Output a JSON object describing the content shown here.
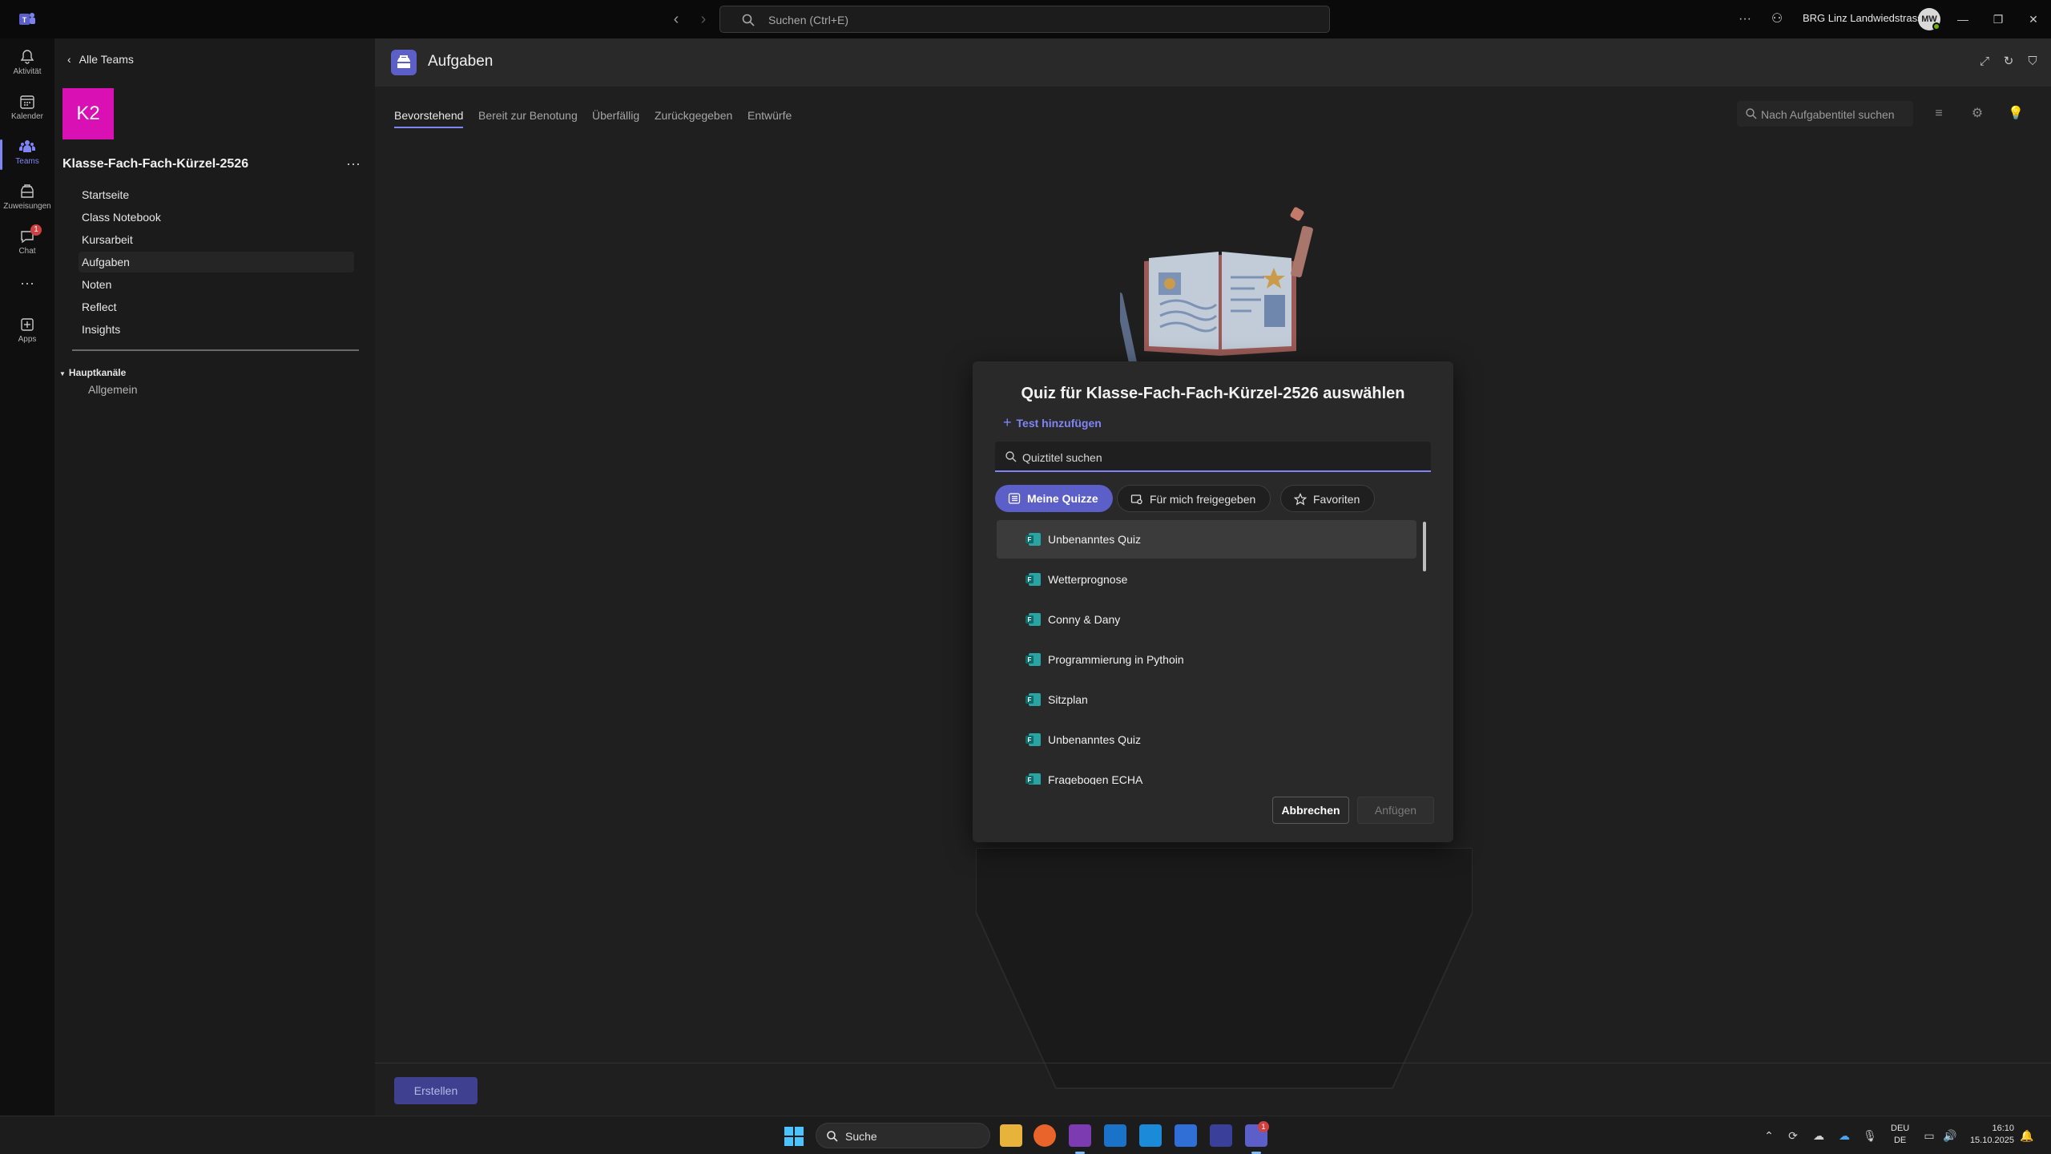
{
  "topbar": {
    "search_placeholder": "Suchen (Ctrl+E)",
    "org_name": "BRG Linz Landwiedstrasse",
    "avatar_initials": "MW"
  },
  "rail": [
    {
      "label": "Aktivität",
      "icon": "bell-icon"
    },
    {
      "label": "Kalender",
      "icon": "calendar-icon"
    },
    {
      "label": "Teams",
      "icon": "teams-icon",
      "active": true
    },
    {
      "label": "Zuweisungen",
      "icon": "assignments-icon"
    },
    {
      "label": "Chat",
      "icon": "chat-icon",
      "badge": "1"
    },
    {
      "label": "Apps",
      "icon": "apps-icon"
    }
  ],
  "team": {
    "back_label": "Alle Teams",
    "avatar_text": "K2",
    "avatar_color": "#d910b4",
    "name": "Klasse-Fach-Fach-Kürzel-2526",
    "nav": [
      "Startseite",
      "Class Notebook",
      "Kursarbeit",
      "Aufgaben",
      "Noten",
      "Reflect",
      "Insights"
    ],
    "active_nav": "Aufgaben",
    "channels_heading": "Hauptkanäle",
    "channels": [
      "Allgemein"
    ]
  },
  "main": {
    "title": "Aufgaben",
    "tabs": [
      "Bevorstehend",
      "Bereit zur Benotung",
      "Überfällig",
      "Zurückgegeben",
      "Entwürfe"
    ],
    "active_tab": "Bevorstehend",
    "search_placeholder": "Nach Aufgabentitel suchen",
    "create_label": "Erstellen"
  },
  "dialog": {
    "title": "Quiz für Klasse-Fach-Fach-Kürzel-2526 auswählen",
    "add_test_label": "Test hinzufügen",
    "search_placeholder": "Quiztitel suchen",
    "filters": [
      "Meine Quizze",
      "Für mich freigegeben",
      "Favoriten"
    ],
    "active_filter": "Meine Quizze",
    "quizzes": [
      "Unbenanntes Quiz",
      "Wetterprognose",
      "Conny & Dany",
      "Programmierung in Pythoin",
      "Sitzplan",
      "Unbenanntes Quiz",
      "Fragebogen ECHA"
    ],
    "cancel_label": "Abbrechen",
    "attach_label": "Anfügen"
  },
  "taskbar": {
    "search_label": "Suche",
    "lang_top": "DEU",
    "lang_bottom": "DE",
    "time": "16:10",
    "date": "15.10.2025",
    "teams_badge": "1"
  },
  "colors": {
    "accent": "#7f85f5",
    "primary_button": "#5b5fc7"
  }
}
